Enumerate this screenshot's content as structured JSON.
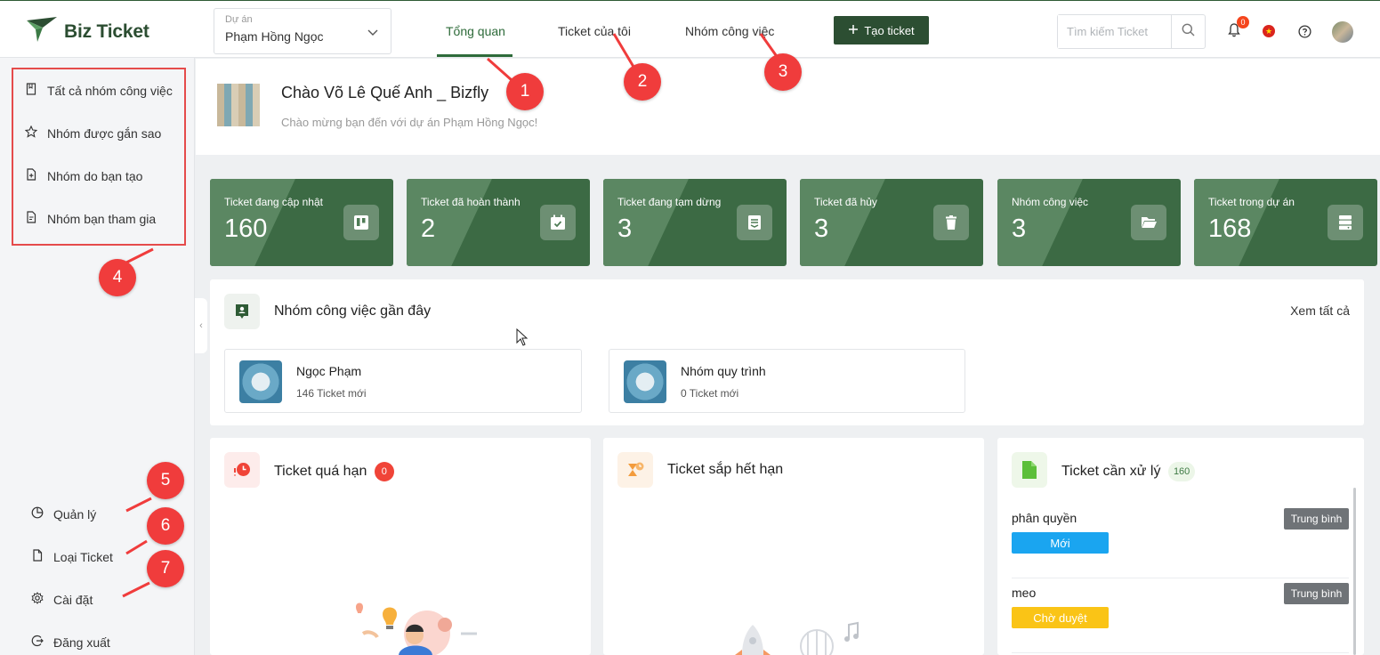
{
  "header": {
    "logo_text": "Biz Ticket",
    "project_label": "Dự án",
    "project_value": "Phạm Hồng Ngọc",
    "tabs": [
      {
        "label": "Tổng quan"
      },
      {
        "label": "Ticket của tôi"
      },
      {
        "label": "Nhóm công việc"
      }
    ],
    "create_button_label": "Tạo ticket",
    "search_placeholder": "Tìm kiếm Ticket",
    "notification_count": "0"
  },
  "sidebar": {
    "items": [
      {
        "label": "Tất cả nhóm công việc",
        "icon": "bookmark-icon"
      },
      {
        "label": "Nhóm được gắn sao",
        "icon": "star-icon"
      },
      {
        "label": "Nhóm do bạn tạo",
        "icon": "file-add-icon"
      },
      {
        "label": "Nhóm bạn tham gia",
        "icon": "file-user-icon"
      }
    ],
    "bottom_items": [
      {
        "label": "Quản lý",
        "icon": "pie-chart-icon"
      },
      {
        "label": "Loại Ticket",
        "icon": "file-icon"
      },
      {
        "label": "Cài đặt",
        "icon": "gear-icon"
      },
      {
        "label": "Đăng xuất",
        "icon": "logout-icon"
      }
    ]
  },
  "welcome": {
    "title": "Chào Võ Lê Quế Anh _ Bizfly",
    "subtitle": "Chào mừng bạn đến với dự án Phạm Hồng Ngọc!"
  },
  "stats": [
    {
      "label": "Ticket đang cập nhật",
      "value": "160",
      "icon": "board-icon"
    },
    {
      "label": "Ticket đã hoàn thành",
      "value": "2",
      "icon": "calendar-check-icon"
    },
    {
      "label": "Ticket đang tạm dừng",
      "value": "3",
      "icon": "archive-icon"
    },
    {
      "label": "Ticket đã hủy",
      "value": "3",
      "icon": "trash-icon"
    },
    {
      "label": "Nhóm công việc",
      "value": "3",
      "icon": "folder-open-icon"
    },
    {
      "label": "Ticket trong dự án",
      "value": "168",
      "icon": "server-icon"
    }
  ],
  "recent": {
    "title": "Nhóm công việc gần đây",
    "see_all": "Xem tất cả",
    "groups": [
      {
        "name": "Ngọc Phạm",
        "count": "146 Ticket mới"
      },
      {
        "name": "Nhóm quy trình",
        "count": "0 Ticket mới"
      }
    ]
  },
  "panels": {
    "overdue": {
      "title": "Ticket quá hạn",
      "count": "0"
    },
    "expiring": {
      "title": "Ticket sắp hết hạn"
    },
    "todo": {
      "title": "Ticket cần xử lý",
      "count": "160",
      "tickets": [
        {
          "name": "phân quyền",
          "priority": "Trung bình",
          "status": "Mới",
          "status_color": "#1aa5f0"
        },
        {
          "name": "meo",
          "priority": "Trung bình",
          "status": "Chờ duyệt",
          "status_color": "#fac416"
        }
      ]
    }
  },
  "annotations": [
    "1",
    "2",
    "3",
    "4",
    "5",
    "6",
    "7"
  ],
  "colors": {
    "brand": "#2c4e32",
    "stat_card": "#3c6a44",
    "marker": "#f03c3c"
  }
}
